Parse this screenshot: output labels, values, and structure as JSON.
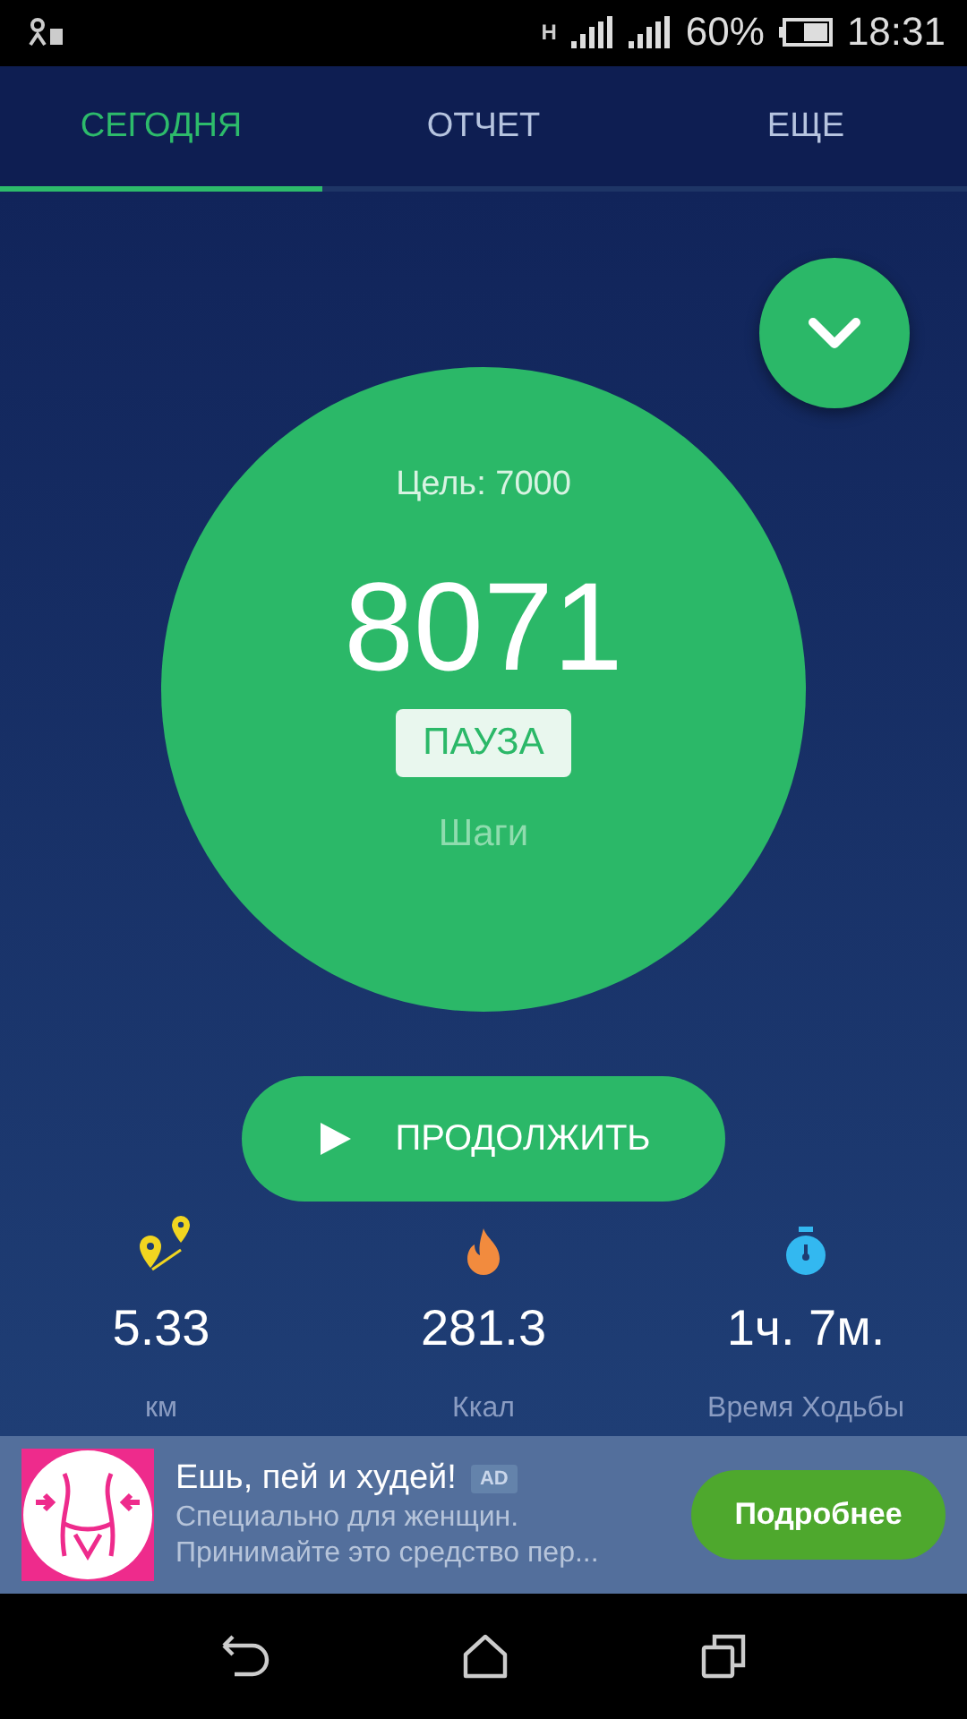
{
  "status_bar": {
    "battery": "60%",
    "time": "18:31",
    "network": "H"
  },
  "tabs": [
    {
      "label": "СЕГОДНЯ",
      "selected": true
    },
    {
      "label": "ОТЧЕТ",
      "selected": false
    },
    {
      "label": "ЕЩЕ",
      "selected": false
    }
  ],
  "steps": {
    "goal": "Цель: 7000",
    "count": "8071",
    "pause_button": "ПАУЗА",
    "unit": "Шаги"
  },
  "continue_button": "ПРОДОЛЖИТЬ",
  "stats": [
    {
      "kind": "distance",
      "value": "5.33",
      "label": "км"
    },
    {
      "kind": "calories",
      "value": "281.3",
      "label": "Ккал"
    },
    {
      "kind": "time",
      "value": "1ч. 7м.",
      "label": "Время Ходьбы"
    }
  ],
  "ad": {
    "title": "Ешь, пей и худей!",
    "badge": "AD",
    "line_1": "Специально для женщин.",
    "line_2": "Принимайте это средство пер...",
    "button": "Подробнее"
  }
}
